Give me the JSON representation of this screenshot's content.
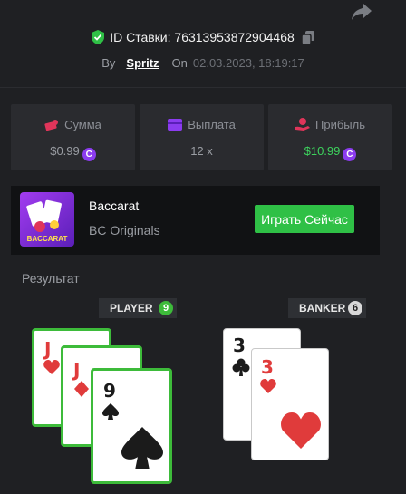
{
  "header": {
    "bet_id_label": "ID Ставки: 76313953872904468",
    "by_label": "By",
    "username": "Spritz",
    "on_label": "On",
    "date": "02.03.2023, 18:19:17"
  },
  "stats": {
    "amount": {
      "label": "Сумма",
      "value": "$0.99"
    },
    "payout": {
      "label": "Выплата",
      "value": "12 x"
    },
    "profit": {
      "label": "Прибыль",
      "value": "$10.99"
    }
  },
  "coin_symbol": "C",
  "game": {
    "name": "Baccarat",
    "provider": "BC Originals",
    "thumb_text": "BACCARAT",
    "play_label": "Играть Сейчас"
  },
  "result": {
    "label": "Результат",
    "player": {
      "label": "PLAYER",
      "score": "9"
    },
    "banker": {
      "label": "BANKER",
      "score": "6"
    }
  },
  "cards": {
    "player": [
      {
        "rank": "J",
        "suit": "heart"
      },
      {
        "rank": "J",
        "suit": "diamond"
      },
      {
        "rank": "9",
        "suit": "spade"
      }
    ],
    "banker": [
      {
        "rank": "3",
        "suit": "club"
      },
      {
        "rank": "3",
        "suit": "heart"
      }
    ]
  },
  "colors": {
    "accent_green": "#2fc046",
    "profit_green": "#3dd35d",
    "coin_purple": "#8c3cf0",
    "red_suit": "#e03b3b"
  }
}
